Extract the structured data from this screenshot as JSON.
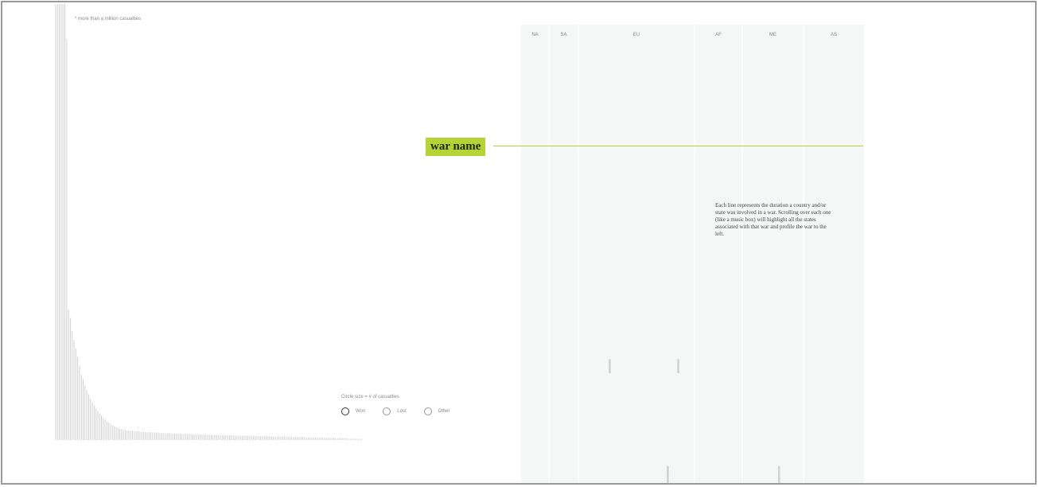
{
  "footnote": "* more than a million casualties",
  "legend": {
    "title": "Circle size = # of casualties",
    "items": [
      "Won",
      "Lost",
      "Other"
    ]
  },
  "war_label": "war name",
  "description": "Each line represents the duration a country and/or state was involved in a war. Scrolling over each one (like a music box) will highlight all the states associated with that war and profile the war to the left.",
  "colors": {
    "accent": "#b5d334",
    "panel": "#f5f6f6",
    "panel_divider": "#ffffff",
    "bar": "#d0d0d0",
    "war_tick": "#cfd1d2"
  },
  "chart_data": [
    {
      "type": "bar",
      "title": "",
      "xlabel": "",
      "ylabel": "",
      "ylim": [
        0,
        100
      ],
      "values": [
        100,
        100,
        100,
        100,
        100,
        100,
        92,
        30,
        28,
        25,
        23,
        21,
        19,
        17,
        15,
        14,
        12.5,
        11.5,
        10.5,
        9.5,
        8.7,
        8,
        7.3,
        6.7,
        6.1,
        5.6,
        5.1,
        4.7,
        4.3,
        4,
        3.7,
        3.4,
        3.2,
        3,
        2.8,
        2.6,
        2.5,
        2.4,
        2.3,
        2.2,
        2.2,
        2.1,
        2.1,
        2,
        2,
        2,
        1.9,
        1.9,
        1.9,
        1.8,
        1.8,
        1.8,
        1.8,
        1.7,
        1.7,
        1.7,
        1.7,
        1.7,
        1.6,
        1.6,
        1.6,
        1.6,
        1.6,
        1.5,
        1.5,
        1.5,
        1.5,
        1.5,
        1.5,
        1.4,
        1.4,
        1.4,
        1.4,
        1.4,
        1.4,
        1.3,
        1.3,
        1.3,
        1.3,
        1.3,
        1.3,
        1.3,
        1.2,
        1.2,
        1.2,
        1.2,
        1.2,
        1.2,
        1.2,
        1.2,
        1.1,
        1.1,
        1.1,
        1.1,
        1.1,
        1.1,
        1.1,
        1.1,
        1,
        1,
        1,
        1,
        1,
        1,
        1,
        1,
        1,
        1,
        0.9,
        0.9,
        0.9,
        0.9,
        0.9,
        0.9,
        0.9,
        0.9,
        0.9,
        0.9,
        0.8,
        0.8,
        0.8,
        0.8,
        0.8,
        0.8,
        0.8,
        0.8,
        0.8,
        0.8,
        0.7,
        0.7,
        0.7,
        0.7,
        0.7,
        0.7,
        0.7,
        0.7,
        0.7,
        0.6,
        0.6,
        0.6,
        0.6,
        0.6,
        0.6,
        0.6,
        0.6,
        0.5,
        0.5,
        0.5,
        0.5,
        0.5,
        0.5,
        0.5,
        0.5,
        0.4,
        0.4,
        0.4,
        0.4,
        0.4,
        0.4,
        0.4,
        0.3,
        0.3,
        0.3,
        0.3,
        0.3,
        0.3,
        0.3,
        0.3
      ]
    },
    {
      "type": "timeline",
      "regions": [
        "NA",
        "SA",
        "EU",
        "AF",
        "ME",
        "AS"
      ],
      "ticks": [
        {
          "region": "EU",
          "pos": 0.27,
          "start": 0.72,
          "end": 0.75
        },
        {
          "region": "EU",
          "pos": 0.86,
          "start": 0.72,
          "end": 0.75
        },
        {
          "region": "EU",
          "pos": 0.77,
          "start": 0.95,
          "end": 1.0
        },
        {
          "region": "ME",
          "pos": 0.6,
          "start": 0.95,
          "end": 1.0
        }
      ]
    }
  ]
}
